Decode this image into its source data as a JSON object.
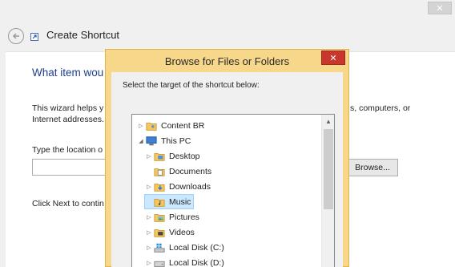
{
  "wizard": {
    "title": "Create Shortcut",
    "heading": "What item wou",
    "desc_line1": "This wizard helps y",
    "desc_line2": "Internet addresses.",
    "desc_right_line1": "s, computers, or",
    "type_label": "Type the location o",
    "browse_label": "Browse...",
    "next_text": "Click Next to contin"
  },
  "dialog": {
    "title": "Browse for Files or Folders",
    "close_glyph": "✕",
    "subtitle": "Select the target of the shortcut below:"
  },
  "tree": [
    {
      "label": "Content BR",
      "icon": "folder-user-icon",
      "expander": "collapsed"
    },
    {
      "label": "This PC",
      "icon": "computer-icon",
      "expander": "expanded"
    },
    {
      "label": "Desktop",
      "icon": "folder-desktop-icon",
      "expander": "collapsed"
    },
    {
      "label": "Documents",
      "icon": "folder-documents-icon",
      "expander": "none"
    },
    {
      "label": "Downloads",
      "icon": "folder-downloads-icon",
      "expander": "collapsed"
    },
    {
      "label": "Music",
      "icon": "folder-music-icon",
      "expander": "none",
      "selected": true
    },
    {
      "label": "Pictures",
      "icon": "folder-pictures-icon",
      "expander": "collapsed"
    },
    {
      "label": "Videos",
      "icon": "folder-videos-icon",
      "expander": "collapsed"
    },
    {
      "label": "Local Disk (C:)",
      "icon": "windows-drive-icon",
      "expander": "collapsed"
    },
    {
      "label": "Local Disk (D:)",
      "icon": "drive-icon",
      "expander": "collapsed"
    }
  ],
  "colors": {
    "dialog_frame": "#f7d789",
    "close_red": "#c7372e",
    "heading_blue": "#1f3e8f",
    "selection": "#cce8ff"
  }
}
